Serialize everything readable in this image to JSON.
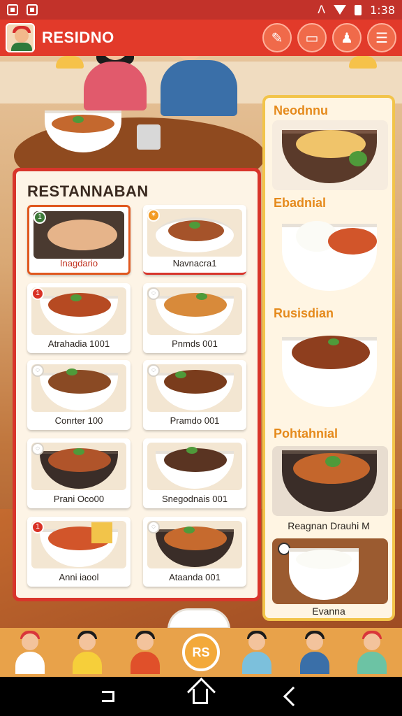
{
  "status_bar": {
    "time": "1:38",
    "icons": [
      "app-icon",
      "app-icon",
      "wifi-icon",
      "battery-icon"
    ]
  },
  "header": {
    "title": "RESIDNO"
  },
  "top_buttons": [
    {
      "icon": "chat-icon"
    },
    {
      "icon": "ticket-icon"
    },
    {
      "icon": "profile-icon"
    },
    {
      "icon": "menu-icon"
    }
  ],
  "menu": {
    "title": "RESTANNABAN",
    "items": [
      {
        "label": "Inagdario",
        "badge": "1",
        "selected": true
      },
      {
        "label": "Navnacra1",
        "badge": "",
        "selected": false
      },
      {
        "label": "Atrahadia 1001",
        "badge": "1",
        "selected": false
      },
      {
        "label": "Pnmds 001",
        "badge": "",
        "selected": false
      },
      {
        "label": "Conrter 100",
        "badge": "",
        "selected": false
      },
      {
        "label": "Pramdo 001",
        "badge": "",
        "selected": false
      },
      {
        "label": "Prani Oco00",
        "badge": "",
        "selected": false
      },
      {
        "label": "Snegodnais 001",
        "badge": "",
        "selected": false
      },
      {
        "label": "Anni iaool",
        "badge": "1",
        "selected": false
      },
      {
        "label": "Ataanda 001",
        "badge": "",
        "selected": false
      }
    ]
  },
  "side": {
    "sections": [
      {
        "title": "Neodnnu",
        "caption": ""
      },
      {
        "title": "Ebadnial",
        "caption": ""
      },
      {
        "title": "Rusisdian",
        "caption": ""
      },
      {
        "title": "Pohtahnial",
        "caption": "Reagnan Drauhi M"
      },
      {
        "title": "",
        "caption": "Evanna"
      }
    ]
  },
  "bottom": {
    "center_label": "RS"
  }
}
